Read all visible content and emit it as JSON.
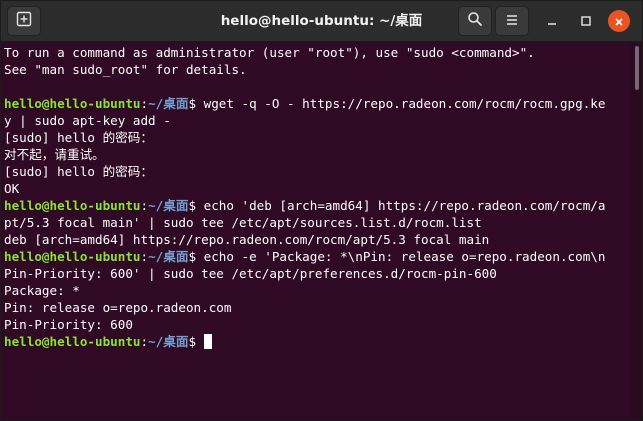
{
  "window": {
    "title": "hello@hello-ubuntu: ~/桌面"
  },
  "icons": {
    "new_tab": "new-tab-icon",
    "search": "search-icon",
    "menu": "hamburger-menu-icon",
    "minimize": "minimize-icon",
    "maximize": "maximize-icon",
    "close": "close-icon"
  },
  "colors": {
    "terminal_background": "#300a24",
    "prompt_user": "#8ae234",
    "prompt_path": "#729fcf",
    "text": "#ffffff",
    "close_button": "#e95420"
  },
  "prompt": {
    "user": "hello@hello-ubuntu",
    "sep": ":",
    "path": "~/桌面",
    "symbol": "$ "
  },
  "terminal": {
    "lines": [
      {
        "kind": "out",
        "text": "To run a command as administrator (user \"root\"), use \"sudo <command>\"."
      },
      {
        "kind": "out",
        "text": "See \"man sudo_root\" for details."
      },
      {
        "kind": "out",
        "text": ""
      },
      {
        "kind": "prompt",
        "text": "wget -q -O - https://repo.radeon.com/rocm/rocm.gpg.ke"
      },
      {
        "kind": "out",
        "text": "y | sudo apt-key add -"
      },
      {
        "kind": "out",
        "text": "[sudo] hello 的密码："
      },
      {
        "kind": "out",
        "text": "对不起，请重试。"
      },
      {
        "kind": "out",
        "text": "[sudo] hello 的密码："
      },
      {
        "kind": "out",
        "text": "OK"
      },
      {
        "kind": "prompt",
        "text": "echo 'deb [arch=amd64] https://repo.radeon.com/rocm/a"
      },
      {
        "kind": "out",
        "text": "pt/5.3 focal main' | sudo tee /etc/apt/sources.list.d/rocm.list"
      },
      {
        "kind": "out",
        "text": "deb [arch=amd64] https://repo.radeon.com/rocm/apt/5.3 focal main"
      },
      {
        "kind": "prompt",
        "text": "echo -e 'Package: *\\nPin: release o=repo.radeon.com\\n"
      },
      {
        "kind": "out",
        "text": "Pin-Priority: 600' | sudo tee /etc/apt/preferences.d/rocm-pin-600"
      },
      {
        "kind": "out",
        "text": "Package: *"
      },
      {
        "kind": "out",
        "text": "Pin: release o=repo.radeon.com"
      },
      {
        "kind": "out",
        "text": "Pin-Priority: 600"
      },
      {
        "kind": "prompt",
        "text": "",
        "cursor": true
      }
    ]
  }
}
